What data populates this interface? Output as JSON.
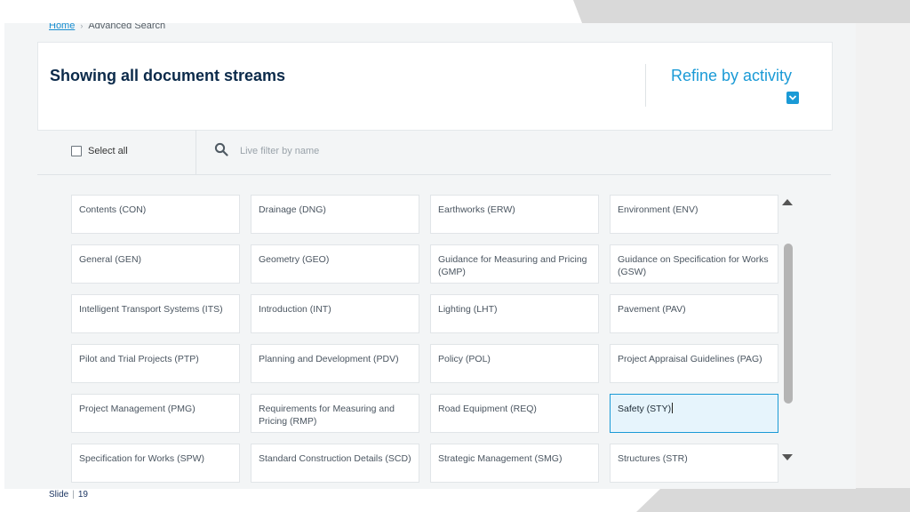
{
  "breadcrumb": {
    "home": "Home",
    "separator": "›",
    "current": "Advanced Search"
  },
  "header": {
    "title": "Showing all document streams",
    "refine_label": "Refine by activity",
    "refine_icon": "chevron-down-icon"
  },
  "filter": {
    "select_all_label": "Select all",
    "select_all_checked": false,
    "search_icon": "search-icon",
    "live_filter_placeholder": "Live filter by name",
    "live_filter_value": ""
  },
  "streams": [
    {
      "label": "Contents (CON)",
      "selected": false
    },
    {
      "label": "Drainage (DNG)",
      "selected": false
    },
    {
      "label": "Earthworks (ERW)",
      "selected": false
    },
    {
      "label": "Environment (ENV)",
      "selected": false
    },
    {
      "label": "General (GEN)",
      "selected": false
    },
    {
      "label": "Geometry (GEO)",
      "selected": false
    },
    {
      "label": "Guidance for Measuring and Pricing (GMP)",
      "selected": false
    },
    {
      "label": "Guidance on Specification for Works (GSW)",
      "selected": false
    },
    {
      "label": "Intelligent Transport Systems (ITS)",
      "selected": false
    },
    {
      "label": "Introduction (INT)",
      "selected": false
    },
    {
      "label": "Lighting (LHT)",
      "selected": false
    },
    {
      "label": "Pavement (PAV)",
      "selected": false
    },
    {
      "label": "Pilot and Trial Projects (PTP)",
      "selected": false
    },
    {
      "label": "Planning and Development (PDV)",
      "selected": false
    },
    {
      "label": "Policy (POL)",
      "selected": false
    },
    {
      "label": "Project Appraisal Guidelines (PAG)",
      "selected": false
    },
    {
      "label": "Project Management (PMG)",
      "selected": false
    },
    {
      "label": "Requirements for Measuring and Pricing (RMP)",
      "selected": false
    },
    {
      "label": "Road Equipment (REQ)",
      "selected": false
    },
    {
      "label": "Safety (STY)",
      "selected": true
    },
    {
      "label": "Specification for Works (SPW)",
      "selected": false
    },
    {
      "label": "Standard Construction Details (SCD)",
      "selected": false
    },
    {
      "label": "Strategic Management (SMG)",
      "selected": false
    },
    {
      "label": "Structures (STR)",
      "selected": false
    }
  ],
  "footer": {
    "slide_label": "Slide",
    "separator": "|",
    "slide_number": "19"
  },
  "colors": {
    "accent": "#1a9ad6",
    "title": "#0b2a4a",
    "selected_bg": "#e6f4fc"
  }
}
